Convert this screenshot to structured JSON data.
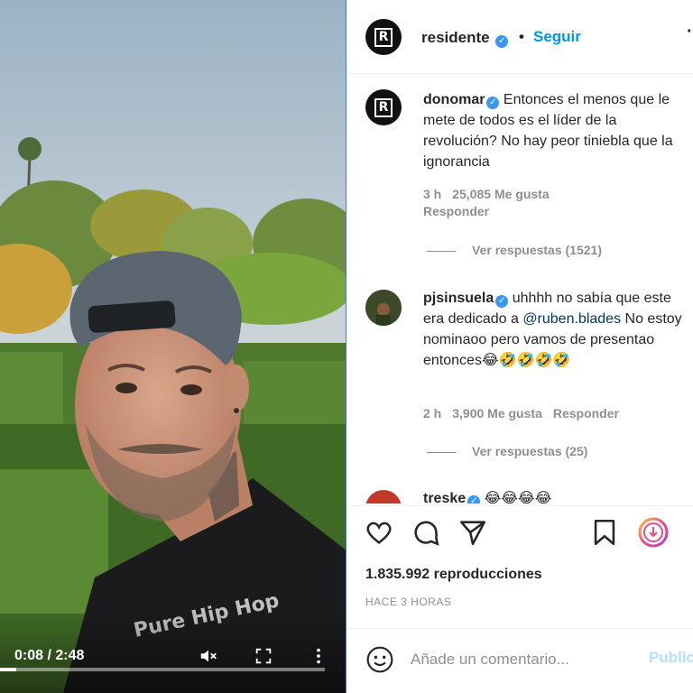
{
  "post": {
    "username": "residente",
    "follow_label": "Seguir",
    "separator": "•",
    "verified": true
  },
  "video": {
    "time": "0:08 / 2:48",
    "progress_fraction": 0.05,
    "shirt_text": "Pure Hip Hop"
  },
  "comments": [
    {
      "username": "donomar",
      "text": "Entonces el menos que le mete de todos es el líder de la revolución? No hay peor tiniebla que la ignorancia",
      "time": "3 h",
      "likes": "25,085 Me gusta",
      "reply_label": "Responder",
      "view_replies": "Ver respuestas (1521)"
    },
    {
      "username": "pjsinsuela",
      "text_before": "uhhhh no sabía que este era dedicado a ",
      "mention": "@ruben.blades",
      "text_after": " No estoy nominaoo pero vamos de presentao entonces😂🤣🤣🤣🤣",
      "time": "2 h",
      "likes": "3,900 Me gusta",
      "reply_label": "Responder",
      "view_replies": "Ver respuestas (25)"
    },
    {
      "username": "treske",
      "text": "😂😂😂😂"
    }
  ],
  "stats": {
    "views": "1.835.992 reproducciones",
    "posted": "HACE 3 HORAS"
  },
  "add_comment": {
    "placeholder": "Añade un comentario...",
    "publish_label": "Publicar"
  },
  "icons": {
    "like": "heart-icon",
    "comment": "comment-bubble-icon",
    "share": "paper-plane-icon",
    "save": "bookmark-icon",
    "download": "download-icon",
    "emoji": "emoji-icon"
  },
  "colors": {
    "link_blue": "#0095f6",
    "mention_blue": "#00376b",
    "muted": "#8e8e8e",
    "publish_disabled": "#b2dffc"
  }
}
